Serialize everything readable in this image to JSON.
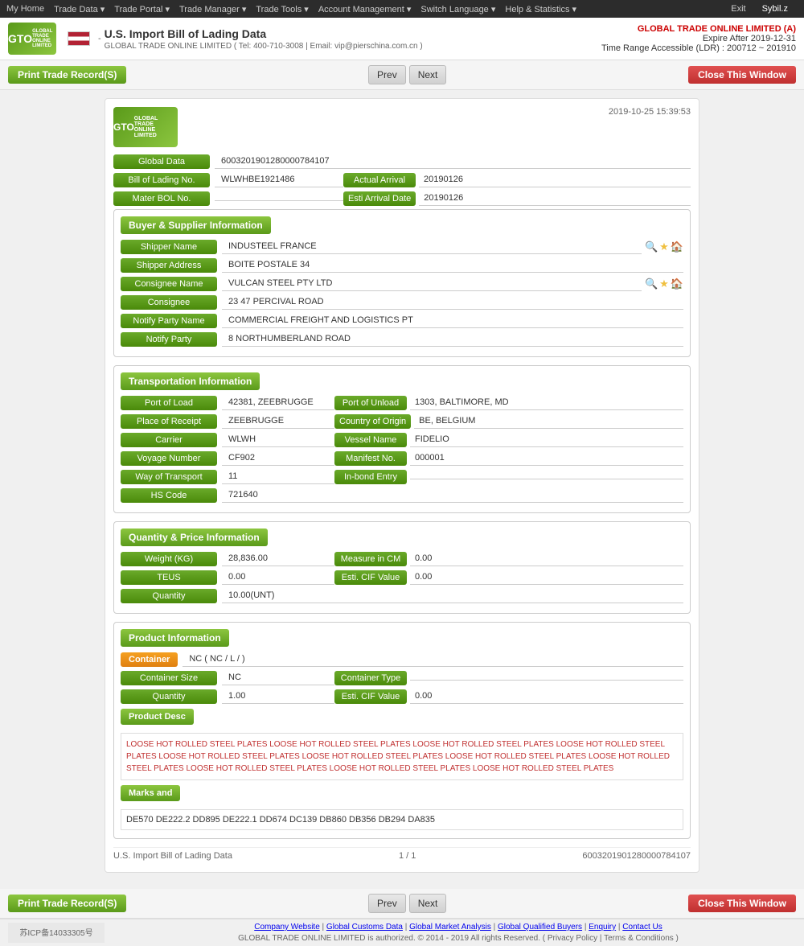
{
  "topnav": {
    "items": [
      "My Home",
      "Trade Data",
      "Trade Portal",
      "Trade Manager",
      "Trade Tools",
      "Account Management",
      "Switch Language",
      "Help & Statistics",
      "Exit"
    ],
    "user": "Sybil.z"
  },
  "header": {
    "logo_text": "GTO",
    "logo_sub": "GLOBAL TRADE ONLINE LIMITED",
    "flag_alt": "US Flag",
    "title": "U.S. Import Bill of Lading Data",
    "contact": "GLOBAL TRADE ONLINE LIMITED ( Tel: 400-710-3008 | Email: vip@pierschina.com.cn )",
    "company": "GLOBAL TRADE ONLINE LIMITED (A)",
    "expire": "Expire After 2019-12-31",
    "time_range": "Time Range Accessible (LDR) : 200712 ~ 201910"
  },
  "toolbar": {
    "print_label": "Print Trade Record(S)",
    "prev_label": "Prev",
    "next_label": "Next",
    "close_label": "Close This Window"
  },
  "record": {
    "timestamp": "2019-10-25 15:39:53",
    "global_data_label": "Global Data",
    "global_data_value": "6003201901280000784107",
    "bol_label": "Bill of Lading No.",
    "bol_value": "WLWHBE1921486",
    "actual_arrival_label": "Actual Arrival",
    "actual_arrival_value": "20190126",
    "master_bol_label": "Mater BOL No.",
    "master_bol_value": "",
    "esti_arrival_label": "Esti Arrival Date",
    "esti_arrival_value": "20190126"
  },
  "buyer_supplier": {
    "section_title": "Buyer & Supplier Information",
    "shipper_name_label": "Shipper Name",
    "shipper_name_value": "INDUSTEEL FRANCE",
    "shipper_address_label": "Shipper Address",
    "shipper_address_value": "BOITE POSTALE 34",
    "consignee_name_label": "Consignee Name",
    "consignee_name_value": "VULCAN STEEL PTY LTD",
    "consignee_label": "Consignee",
    "consignee_value": "23 47 PERCIVAL ROAD",
    "notify_party_name_label": "Notify Party Name",
    "notify_party_name_value": "COMMERCIAL FREIGHT AND LOGISTICS PT",
    "notify_party_label": "Notify Party",
    "notify_party_value": "8 NORTHUMBERLAND ROAD"
  },
  "transportation": {
    "section_title": "Transportation Information",
    "port_of_load_label": "Port of Load",
    "port_of_load_value": "42381, ZEEBRUGGE",
    "port_of_unload_label": "Port of Unload",
    "port_of_unload_value": "1303, BALTIMORE, MD",
    "place_of_receipt_label": "Place of Receipt",
    "place_of_receipt_value": "ZEEBRUGGE",
    "country_of_origin_label": "Country of Origin",
    "country_of_origin_value": "BE, BELGIUM",
    "carrier_label": "Carrier",
    "carrier_value": "WLWH",
    "vessel_name_label": "Vessel Name",
    "vessel_name_value": "FIDELIO",
    "voyage_number_label": "Voyage Number",
    "voyage_number_value": "CF902",
    "manifest_no_label": "Manifest No.",
    "manifest_no_value": "000001",
    "way_of_transport_label": "Way of Transport",
    "way_of_transport_value": "11",
    "inbond_entry_label": "In-bond Entry",
    "inbond_entry_value": "",
    "hs_code_label": "HS Code",
    "hs_code_value": "721640"
  },
  "quantity_price": {
    "section_title": "Quantity & Price Information",
    "weight_label": "Weight (KG)",
    "weight_value": "28,836.00",
    "measure_label": "Measure in CM",
    "measure_value": "0.00",
    "teus_label": "TEUS",
    "teus_value": "0.00",
    "esti_cif_label": "Esti. CIF Value",
    "esti_cif_value": "0.00",
    "quantity_label": "Quantity",
    "quantity_value": "10.00(UNT)"
  },
  "product_info": {
    "section_title": "Product Information",
    "container_label": "Container",
    "container_value": "NC ( NC / L / )",
    "container_size_label": "Container Size",
    "container_size_value": "NC",
    "container_type_label": "Container Type",
    "container_type_value": "",
    "quantity_label": "Quantity",
    "quantity_value": "1.00",
    "esti_cif_label": "Esti. CIF Value",
    "esti_cif_value": "0.00",
    "product_desc_label": "Product Desc",
    "product_desc_value": "LOOSE HOT ROLLED STEEL PLATES LOOSE HOT ROLLED STEEL PLATES LOOSE HOT ROLLED STEEL PLATES LOOSE HOT ROLLED STEEL PLATES LOOSE HOT ROLLED STEEL PLATES LOOSE HOT ROLLED STEEL PLATES LOOSE HOT ROLLED STEEL PLATES LOOSE HOT ROLLED STEEL PLATES LOOSE HOT ROLLED STEEL PLATES LOOSE HOT ROLLED STEEL PLATES LOOSE HOT ROLLED STEEL PLATES",
    "marks_label": "Marks and",
    "marks_value": "DE570 DE222.2 DD895 DE222.1 DD674 DC139 DB860 DB356 DB294 DA835"
  },
  "record_footer": {
    "label": "U.S. Import Bill of Lading Data",
    "page": "1 / 1",
    "id": "6003201901280000784107"
  },
  "bottom_footer": {
    "icp": "苏ICP备14033305号",
    "links": [
      "Company Website",
      "Global Customs Data",
      "Global Market Analysis",
      "Global Qualified Buyers",
      "Enquiry",
      "Contact Us"
    ],
    "copyright": "GLOBAL TRADE ONLINE LIMITED is authorized. © 2014 - 2019 All rights Reserved.  ( Privacy Policy | Terms & Conditions )"
  }
}
